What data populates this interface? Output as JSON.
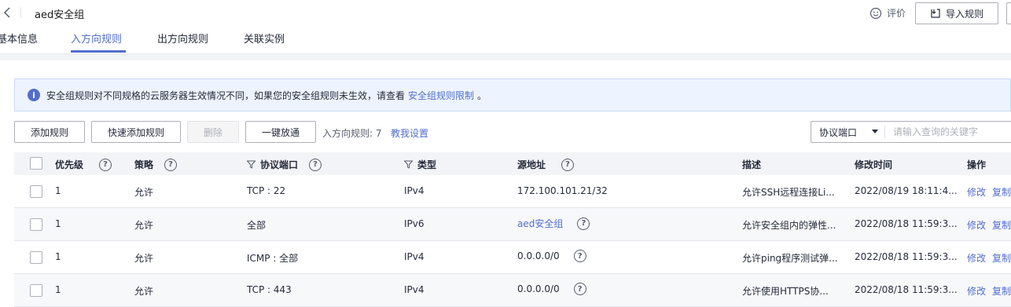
{
  "header": {
    "title": "aed安全组",
    "evaluate_label": "评价",
    "import_rules_label": "导入规则"
  },
  "tabs": [
    {
      "label": "基本信息"
    },
    {
      "label": "入方向规则"
    },
    {
      "label": "出方向规则"
    },
    {
      "label": "关联实例"
    }
  ],
  "notice": {
    "text": "安全组规则对不同规格的云服务器生效情况不同，如果您的安全组规则未生效，请查看",
    "link": "安全组规则限制",
    "suffix": "。"
  },
  "toolbar": {
    "add_rule": "添加规则",
    "quick_add_rule": "快速添加规则",
    "delete": "删除",
    "one_click_open": "一键放通",
    "inbound_count": "入方向规则: 7",
    "guide_link": "教我设置",
    "filter_select": "协议端口",
    "search_placeholder": "请输入查询的关键字"
  },
  "table": {
    "columns": [
      "优先级",
      "策略",
      "协议端口",
      "类型",
      "源地址",
      "描述",
      "修改时间",
      "操作"
    ],
    "rows": [
      {
        "priority": "1",
        "policy": "允许",
        "port": "TCP : 22",
        "type": "IPv4",
        "source": "172.100.101.21/32",
        "source_is_link": false,
        "description": "允许SSH远程连接Li...",
        "modified": "2022/08/19 18:11:4...",
        "op1": "修改",
        "op2": "复制"
      },
      {
        "priority": "1",
        "policy": "允许",
        "port": "全部",
        "type": "IPv6",
        "source": "aed安全组",
        "source_is_link": true,
        "description": "允许安全组内的弹性...",
        "modified": "2022/08/18 11:59:3...",
        "op1": "修改",
        "op2": "复制"
      },
      {
        "priority": "1",
        "policy": "允许",
        "port": "ICMP : 全部",
        "type": "IPv4",
        "source": "0.0.0.0/0",
        "source_is_link": false,
        "description": "允许ping程序测试弹...",
        "modified": "2022/08/18 11:59:3...",
        "op1": "修改",
        "op2": "复制"
      },
      {
        "priority": "1",
        "policy": "允许",
        "port": "TCP : 443",
        "type": "IPv4",
        "source": "0.0.0.0/0",
        "source_is_link": false,
        "description": "允许使用HTTPS协...",
        "modified": "2022/08/18 11:59:3...",
        "op1": "修改",
        "op2": "复制"
      }
    ]
  },
  "colors": {
    "accent": "#526ecc",
    "notice_bg": "#edf4ff"
  }
}
